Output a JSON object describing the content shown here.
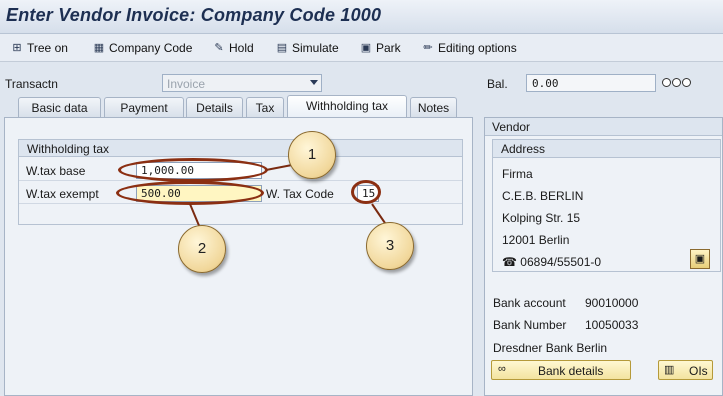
{
  "title": "Enter Vendor Invoice: Company Code 1000",
  "toolbar": {
    "tree_on": "Tree on",
    "company_code": "Company Code",
    "hold": "Hold",
    "simulate": "Simulate",
    "park": "Park",
    "editing_options": "Editing options"
  },
  "header": {
    "transactn_label": "Transactn",
    "transactn_value": "Invoice",
    "bal_label": "Bal.",
    "bal_value": "0.00"
  },
  "tabs": [
    "Basic data",
    "Payment",
    "Details",
    "Tax",
    "Withholding tax",
    "Notes"
  ],
  "withholding": {
    "group_title": "Withholding tax",
    "wtax_base_label": "W.tax base",
    "wtax_base_value": "1,000.00",
    "wtax_exempt_label": "W.tax exempt",
    "wtax_exempt_value": "500.00",
    "wtax_code_label": "W. Tax Code",
    "wtax_code_value": "15"
  },
  "callouts": [
    "1",
    "2",
    "3"
  ],
  "vendor": {
    "title": "Vendor",
    "address_title": "Address",
    "lines": [
      "Firma",
      "C.E.B. BERLIN",
      "Kolping Str. 15",
      "12001 Berlin"
    ],
    "phone": "06894/55501-0",
    "bank_account_label": "Bank account",
    "bank_account_value": "90010000",
    "bank_number_label": "Bank Number",
    "bank_number_value": "10050033",
    "bank_name": "Dresdner Bank Berlin",
    "bank_details_button": "Bank details",
    "ois_button": "OIs"
  }
}
